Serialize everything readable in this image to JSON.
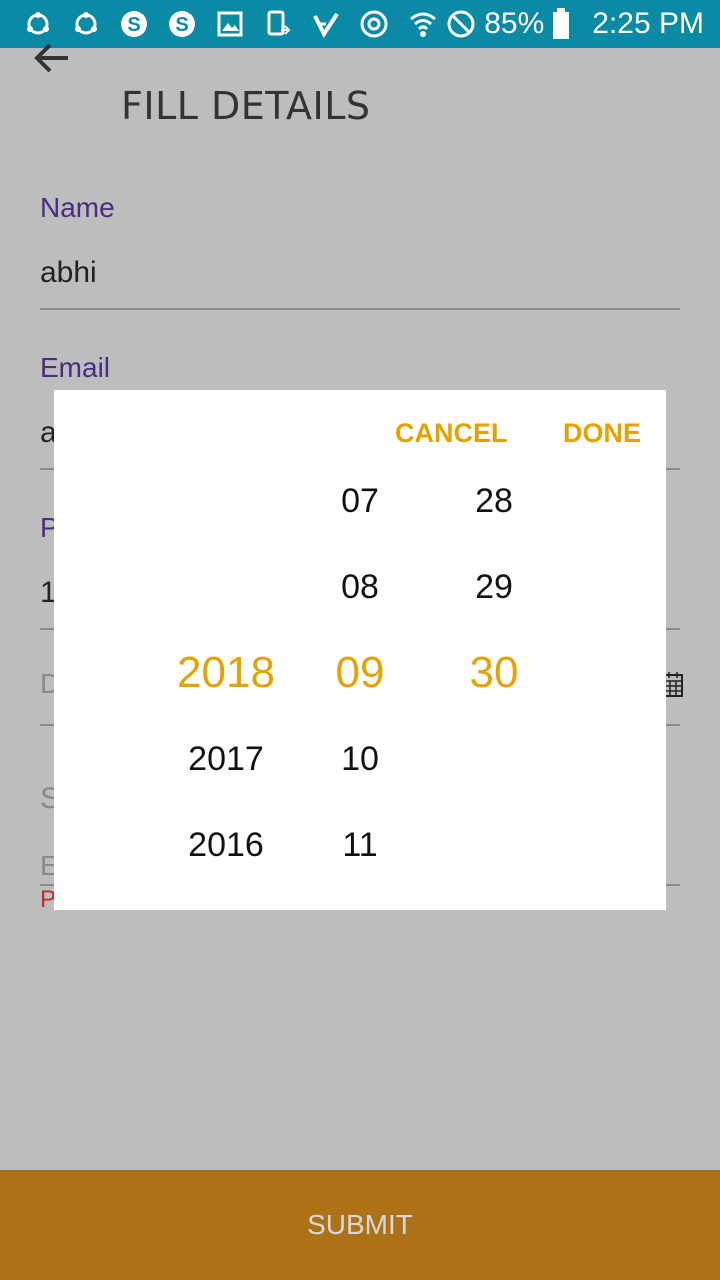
{
  "status_bar": {
    "battery": "85%",
    "time": "2:25 PM",
    "icons": [
      "sync-icon",
      "sync-icon",
      "skype-icon",
      "skype-icon",
      "gallery-icon",
      "phone-icon",
      "check-icon",
      "chrome-icon",
      "wifi-icon",
      "block-icon",
      "battery-icon"
    ]
  },
  "toolbar": {
    "title": "FILL DETAILS"
  },
  "form": {
    "name_label": "Name",
    "name_value": "abhi",
    "email_label": "Email",
    "email_value_partial": "a",
    "phone_label_partial": "P",
    "phone_value_partial": "1",
    "date_hint_partial": "D",
    "section_partial": "S",
    "email2_partial": "E",
    "error_partial": "P"
  },
  "submit_label": "SUBMIT",
  "dialog": {
    "cancel_label": "CANCEL",
    "done_label": "DONE",
    "years": [
      "2018",
      "2017",
      "2016"
    ],
    "months": [
      "07",
      "08",
      "09",
      "10",
      "11"
    ],
    "days": [
      "28",
      "29",
      "30"
    ],
    "selected": {
      "year": "2018",
      "month": "09",
      "day": "30"
    },
    "accent_color": "#e6a200"
  }
}
